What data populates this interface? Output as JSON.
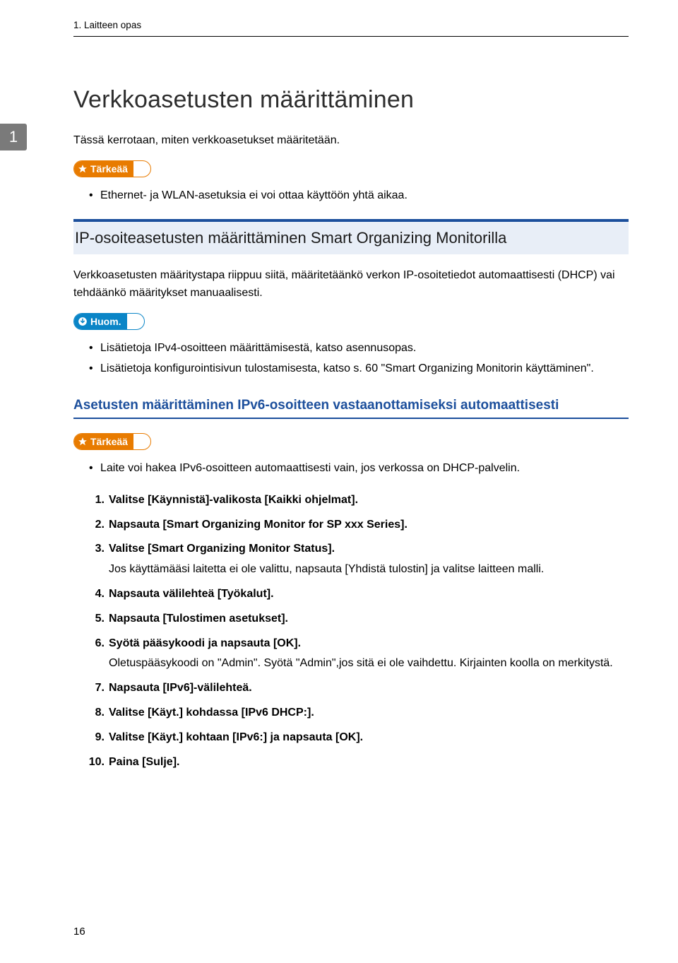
{
  "chapter_label": "1. Laitteen opas",
  "tab_number": "1",
  "title": "Verkkoasetusten määrittäminen",
  "intro": "Tässä kerrotaan, miten verkkoasetukset määritetään.",
  "badge_important": "Tärkeää",
  "badge_note": "Huom.",
  "top_bullets": [
    "Ethernet- ja WLAN-asetuksia ei voi ottaa käyttöön yhtä aikaa."
  ],
  "section_heading": "IP-osoiteasetusten määrittäminen Smart Organizing Monitorilla",
  "section_para": "Verkkoasetusten määritystapa riippuu siitä, määritetäänkö verkon IP-osoitetiedot automaattisesti (DHCP) vai tehdäänkö määritykset manuaalisesti.",
  "note_bullets": [
    "Lisätietoja IPv4-osoitteen määrittämisestä, katso asennusopas.",
    "Lisätietoja konfigurointisivun tulostamisesta, katso s. 60 \"Smart Organizing Monitorin käyttäminen\"."
  ],
  "subsection_heading": "Asetusten määrittäminen IPv6-osoitteen vastaanottamiseksi automaattisesti",
  "sub_bullets": [
    "Laite voi hakea IPv6-osoitteen automaattisesti vain, jos verkossa on DHCP-palvelin."
  ],
  "steps": [
    {
      "main": "Valitse [Käynnistä]-valikosta [Kaikki ohjelmat]."
    },
    {
      "main": "Napsauta [Smart Organizing Monitor for SP xxx Series]."
    },
    {
      "main": "Valitse [Smart Organizing Monitor Status].",
      "note": "Jos käyttämääsi laitetta ei ole valittu, napsauta [Yhdistä tulostin] ja valitse laitteen malli."
    },
    {
      "main": "Napsauta välilehteä [Työkalut]."
    },
    {
      "main": "Napsauta [Tulostimen asetukset]."
    },
    {
      "main": "Syötä pääsykoodi ja napsauta [OK].",
      "note": "Oletuspääsykoodi on \"Admin\". Syötä \"Admin\",jos sitä ei ole vaihdettu. Kirjainten koolla on merkitystä."
    },
    {
      "main": "Napsauta [IPv6]-välilehteä."
    },
    {
      "main": "Valitse [Käyt.] kohdassa [IPv6 DHCP:]."
    },
    {
      "main": "Valitse [Käyt.] kohtaan [IPv6:] ja napsauta [OK]."
    },
    {
      "main": "Paina [Sulje]."
    }
  ],
  "page_number": "16"
}
